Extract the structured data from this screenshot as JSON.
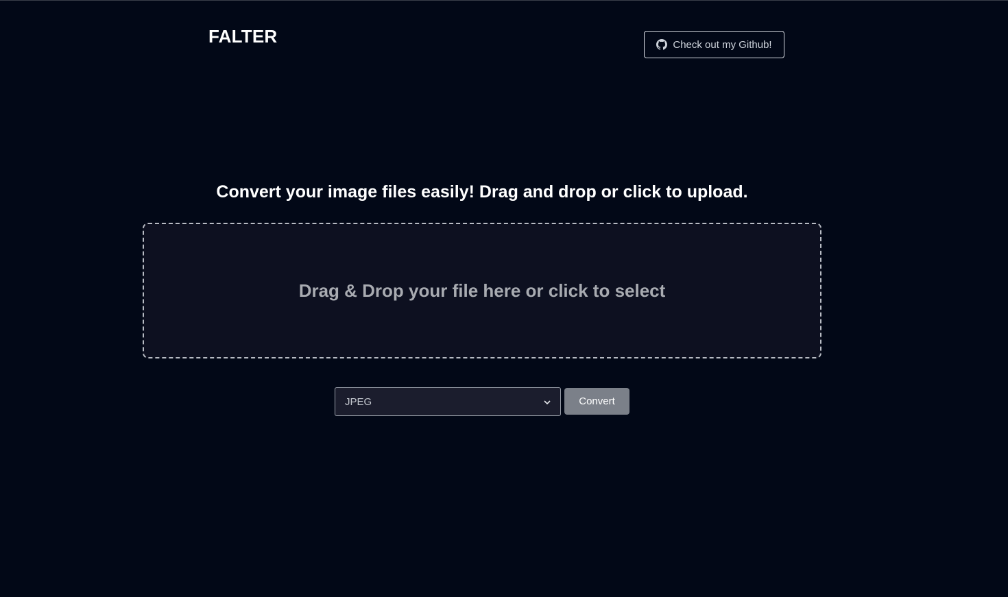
{
  "header": {
    "brand": "FALTER",
    "github_button_label": "Check out my Github!",
    "github_icon": "github-icon"
  },
  "main": {
    "headline": "Convert your image files easily! Drag and drop or click to upload.",
    "dropzone_text": "Drag & Drop your file here or click to select",
    "format_select": {
      "selected": "JPEG",
      "icon": "chevron-down-icon"
    },
    "convert_label": "Convert"
  },
  "colors": {
    "background": "#020817",
    "dropzone_bg": "#0d1020",
    "button_gray": "#7b8089"
  }
}
